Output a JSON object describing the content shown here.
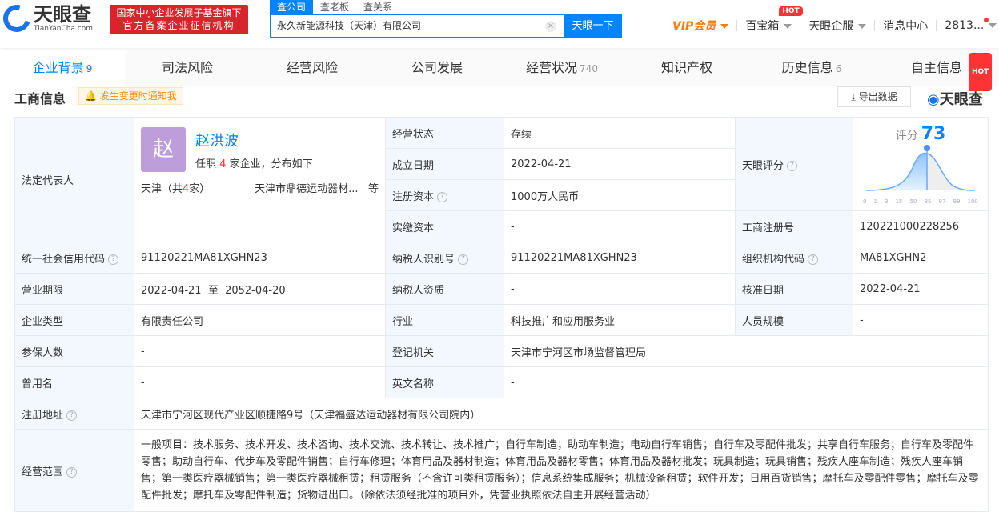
{
  "header": {
    "logo_text": "天眼查",
    "logo_sub": "TianYanCha.com",
    "badge_line1": "国家中小企业发展子基金旗下",
    "badge_line2": "官方备案企业征信机构",
    "search_tabs": [
      "查公司",
      "查老板",
      "查关系"
    ],
    "search_value": "永久新能源科技（天津）有限公司",
    "clear": "×",
    "search_button": "天眼一下",
    "vip": "VIP会员",
    "baobaoxiang": "百宝箱",
    "hot": "HOT",
    "qifu": "天眼企服",
    "messages": "消息中心",
    "user": "2813..."
  },
  "tabs": [
    {
      "label": "企业背景",
      "count": "9"
    },
    {
      "label": "司法风险",
      "count": ""
    },
    {
      "label": "经营风险",
      "count": ""
    },
    {
      "label": "公司发展",
      "count": ""
    },
    {
      "label": "经营状况",
      "count": "740"
    },
    {
      "label": "知识产权",
      "count": ""
    },
    {
      "label": "历史信息",
      "count": "6"
    },
    {
      "label": "自主信息",
      "count": ""
    }
  ],
  "section": {
    "title": "工商信息",
    "notify": "发生变更时通知我",
    "export": "导出数据",
    "brand": "天眼查"
  },
  "info": {
    "legal_rep_label": "法定代表人",
    "avatar_char": "赵",
    "legal_rep_name": "赵洪波",
    "pos_pre": "任职",
    "pos_count": "4",
    "pos_post": "家企业，分布如下",
    "region_pre": "天津（共",
    "region_count": "4",
    "region_post": "家）",
    "company_sample": "天津市鼎德运动器材...",
    "etc": "等",
    "status_label": "经营状态",
    "status": "存续",
    "found_label": "成立日期",
    "found": "2022-04-21",
    "capital_label": "注册资本",
    "capital": "1000万人民币",
    "paid_label": "实缴资本",
    "paid": "-",
    "score_label": "天眼评分",
    "score_word": "评分",
    "score": "73",
    "score_ticks": [
      "0",
      "1",
      "3",
      "15",
      "50",
      "85",
      "97",
      "99",
      "100"
    ],
    "regno_label": "工商注册号",
    "regno": "120221000228256",
    "credit_label": "统一社会信用代码",
    "credit": "91120221MA81XGHN23",
    "taxid_label": "纳税人识别号",
    "taxid": "91120221MA81XGHN23",
    "org_label": "组织机构代码",
    "org": "MA81XGHN2",
    "term_label": "营业期限",
    "term": "2022-04-21  至  2052-04-20",
    "taxq_label": "纳税人资质",
    "taxq": "-",
    "approve_label": "核准日期",
    "approve": "2022-04-21",
    "type_label": "企业类型",
    "type": "有限责任公司",
    "industry_label": "行业",
    "industry": "科技推广和应用服务业",
    "size_label": "人员规模",
    "size": "-",
    "insured_label": "参保人数",
    "insured": "-",
    "authority_label": "登记机关",
    "authority": "天津市宁河区市场监督管理局",
    "former_label": "曾用名",
    "former": "-",
    "en_label": "英文名称",
    "en": "-",
    "addr_label": "注册地址",
    "addr": "天津市宁河区现代产业区顺捷路9号（天津福盛达运动器材有限公司院内）",
    "scope_label": "经营范围",
    "scope": "一般项目：技术服务、技术开发、技术咨询、技术交流、技术转让、技术推广；自行车制造；助动车制造；电动自行车销售；自行车及零配件批发；共享自行车服务；自行车及零配件零售；助动自行车、代步车及零配件销售；自行车修理；体育用品及器材制造；体育用品及器材零售；体育用品及器材批发；玩具制造；玩具销售；残疾人座车制造；残疾人座车销售；第一类医疗器械销售；第一类医疗器械租赁；租赁服务（不含许可类租赁服务）；信息系统集成服务；机械设备租赁；软件开发；日用百货销售；摩托车及零配件零售；摩托车及零配件批发；摩托车及零配件制造；货物进出口。（除依法须经批准的项目外，凭营业执照依法自主开展经营活动）"
  }
}
